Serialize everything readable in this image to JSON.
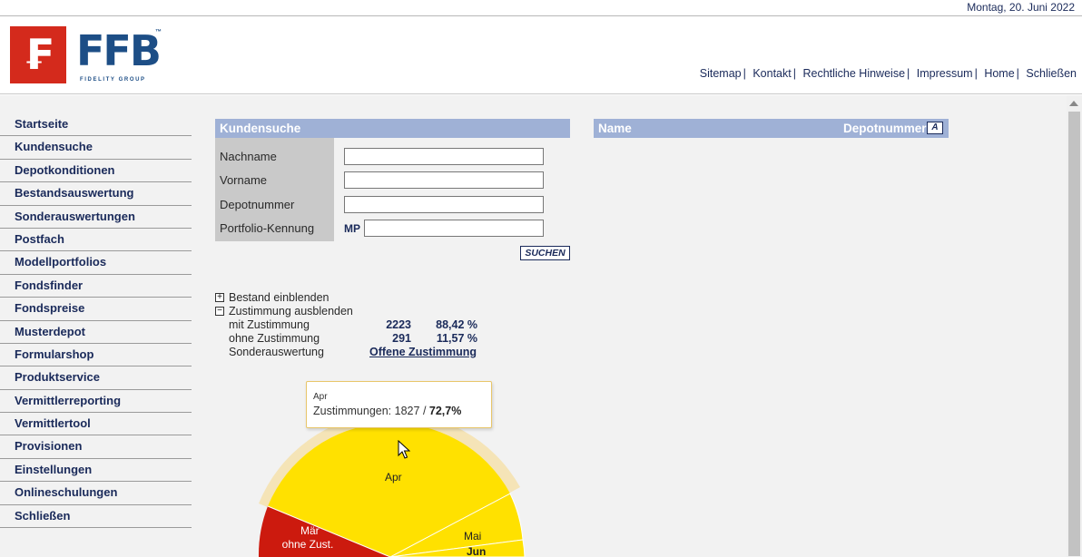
{
  "date": "Montag, 20. Juni 2022",
  "brand": {
    "logo_text": "FFB",
    "tm": "™",
    "sub": "FIDELITY GROUP",
    "mark": "₣"
  },
  "top_links": [
    "Sitemap",
    "Kontakt",
    "Rechtliche Hinweise",
    "Impressum",
    "Home",
    "Schließen"
  ],
  "sidebar": {
    "items": [
      "Startseite",
      "Kundensuche",
      "Depotkonditionen",
      "Bestandsauswertung",
      "Sonderauswertungen",
      "Postfach",
      "Modellportfolios",
      "Fondsfinder",
      "Fondspreise",
      "Musterdepot",
      "Formularshop",
      "Produktservice",
      "Vermittlerreporting",
      "Vermittlertool",
      "Provisionen",
      "Einstellungen",
      "Onlineschulungen",
      "Schließen"
    ]
  },
  "search": {
    "title": "Kundensuche",
    "labels": {
      "nachname": "Nachname",
      "vorname": "Vorname",
      "depotnummer": "Depotnummer",
      "portfolio": "Portfolio-Kennung"
    },
    "values": {
      "nachname": "",
      "vorname": "",
      "depotnummer": "",
      "portfolio": ""
    },
    "mp_prefix": "MP",
    "button": "SUCHEN"
  },
  "results": {
    "col_name": "Name",
    "col_depot": "Depotnummer",
    "sort_label": "A"
  },
  "stats": {
    "toggle_bestand": "Bestand einblenden",
    "toggle_zustimmung": "Zustimmung ausblenden",
    "toggle_plus": "+",
    "toggle_minus": "−",
    "rows": [
      {
        "label": "mit Zustimmung",
        "count": "2223",
        "percent": "88,42 %"
      },
      {
        "label": "ohne Zustimmung",
        "count": "291",
        "percent": "11,57 %"
      }
    ],
    "sonder_label": "Sonderauswertung",
    "sonder_link": "Offene Zustimmung"
  },
  "chart_data": {
    "type": "pie",
    "slice_labels": [
      "Apr",
      "Mai",
      "Jun",
      "Mär\nohne Zust."
    ],
    "colors": {
      "zustimmung": "#ffe100",
      "ohne": "#cc1a0e",
      "hover_halo": "#f5e2b0"
    },
    "tooltip": {
      "month": "Apr",
      "label": "Zustimmungen:",
      "count": "1827",
      "sep": "/",
      "percent": "72,7%"
    }
  }
}
